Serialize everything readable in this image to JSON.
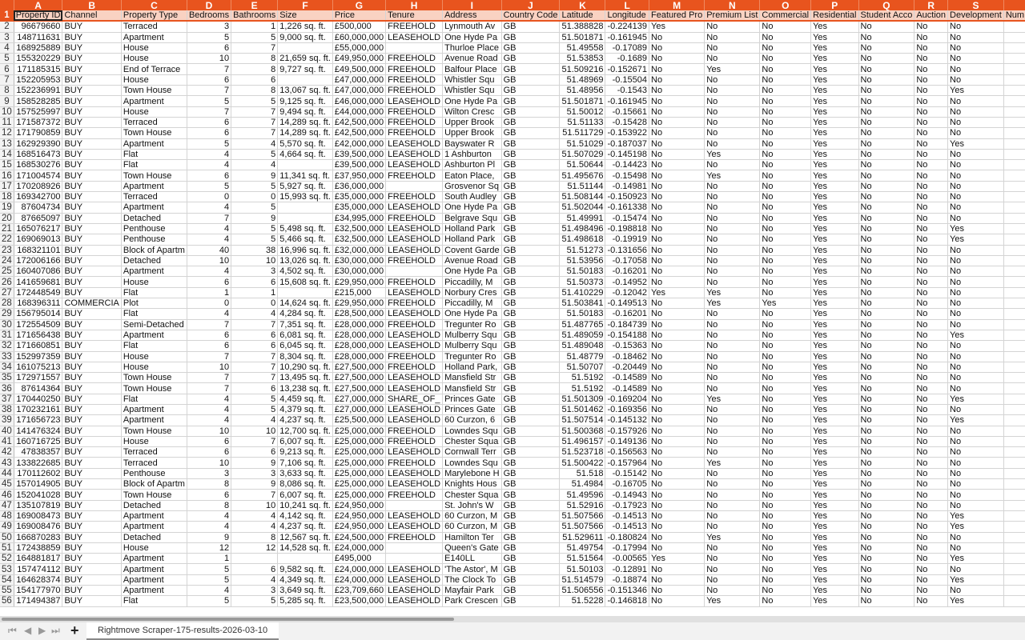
{
  "columns": [
    "A",
    "B",
    "C",
    "D",
    "E",
    "F",
    "G",
    "H",
    "I",
    "J",
    "K",
    "L",
    "M",
    "N",
    "O",
    "P",
    "Q",
    "R",
    "S",
    ""
  ],
  "headers": [
    "Property ID",
    "Channel",
    "Property Type",
    "Bedrooms",
    "Bathrooms",
    "Size",
    "Price",
    "Tenure",
    "Address",
    "Country Code",
    "Latitude",
    "Longitude",
    "Featured Pro",
    "Premium List",
    "Commercial",
    "Residential",
    "Student Acco",
    "Auction",
    "Development",
    "Num"
  ],
  "rows": [
    [
      "96679660",
      "BUY",
      "Terraced",
      "3",
      "1",
      "1,226 sq. ft.",
      "£500,000",
      "FREEHOLD",
      "Lynmouth Av",
      "GB",
      "51.388828",
      "-0.224139",
      "Yes",
      "No",
      "No",
      "Yes",
      "No",
      "No",
      "No"
    ],
    [
      "148711631",
      "BUY",
      "Apartment",
      "5",
      "5",
      "9,000 sq. ft.",
      "£60,000,000",
      "LEASEHOLD",
      "One Hyde Pa",
      "GB",
      "51.501871",
      "-0.161945",
      "No",
      "No",
      "No",
      "Yes",
      "No",
      "No",
      "No"
    ],
    [
      "168925889",
      "BUY",
      "House",
      "6",
      "7",
      "",
      "£55,000,000",
      "",
      "Thurloe Place",
      "GB",
      "51.49558",
      "-0.17089",
      "No",
      "No",
      "No",
      "Yes",
      "No",
      "No",
      "No"
    ],
    [
      "155320229",
      "BUY",
      "House",
      "10",
      "8",
      "21,659 sq. ft.",
      "£49,950,000",
      "FREEHOLD",
      "Avenue Road",
      "GB",
      "51.53853",
      "-0.1689",
      "No",
      "No",
      "No",
      "Yes",
      "No",
      "No",
      "No"
    ],
    [
      "171185315",
      "BUY",
      "End of Terrace",
      "7",
      "8",
      "9,727 sq. ft.",
      "£49,500,000",
      "FREEHOLD",
      "Balfour Place",
      "GB",
      "51.509216",
      "-0.152671",
      "No",
      "Yes",
      "No",
      "Yes",
      "No",
      "No",
      "No"
    ],
    [
      "152205953",
      "BUY",
      "House",
      "6",
      "6",
      "",
      "£47,000,000",
      "FREEHOLD",
      "Whistler Squ",
      "GB",
      "51.48969",
      "-0.15504",
      "No",
      "No",
      "No",
      "Yes",
      "No",
      "No",
      "No"
    ],
    [
      "152236991",
      "BUY",
      "Town House",
      "7",
      "8",
      "13,067 sq. ft.",
      "£47,000,000",
      "FREEHOLD",
      "Whistler Squ",
      "GB",
      "51.48956",
      "-0.1543",
      "No",
      "No",
      "No",
      "Yes",
      "No",
      "No",
      "Yes"
    ],
    [
      "158528285",
      "BUY",
      "Apartment",
      "5",
      "5",
      "9,125 sq. ft.",
      "£46,000,000",
      "LEASEHOLD",
      "One Hyde Pa",
      "GB",
      "51.501871",
      "-0.161945",
      "No",
      "No",
      "No",
      "Yes",
      "No",
      "No",
      "No"
    ],
    [
      "157525997",
      "BUY",
      "House",
      "7",
      "7",
      "9,494 sq. ft.",
      "£44,000,000",
      "FREEHOLD",
      "Wilton Cresc",
      "GB",
      "51.50012",
      "-0.15661",
      "No",
      "No",
      "No",
      "Yes",
      "No",
      "No",
      "No"
    ],
    [
      "171587372",
      "BUY",
      "Terraced",
      "6",
      "7",
      "14,289 sq. ft.",
      "£42,500,000",
      "FREEHOLD",
      "Upper Brook",
      "GB",
      "51.51133",
      "-0.15428",
      "No",
      "No",
      "No",
      "Yes",
      "No",
      "No",
      "No"
    ],
    [
      "171790859",
      "BUY",
      "Town House",
      "6",
      "7",
      "14,289 sq. ft.",
      "£42,500,000",
      "FREEHOLD",
      "Upper Brook",
      "GB",
      "51.511729",
      "-0.153922",
      "No",
      "No",
      "No",
      "Yes",
      "No",
      "No",
      "No"
    ],
    [
      "162929390",
      "BUY",
      "Apartment",
      "5",
      "4",
      "5,570 sq. ft.",
      "£42,000,000",
      "LEASEHOLD",
      "Bayswater R",
      "GB",
      "51.51029",
      "-0.187037",
      "No",
      "No",
      "No",
      "Yes",
      "No",
      "No",
      "Yes"
    ],
    [
      "168516473",
      "BUY",
      "Flat",
      "4",
      "5",
      "4,664 sq. ft.",
      "£39,500,000",
      "LEASEHOLD",
      "1 Ashburton",
      "GB",
      "51.507029",
      "-0.145198",
      "No",
      "Yes",
      "No",
      "Yes",
      "No",
      "No",
      "No"
    ],
    [
      "168530276",
      "BUY",
      "Flat",
      "4",
      "4",
      "",
      "£39,500,000",
      "LEASEHOLD",
      "Ashburton Pl",
      "GB",
      "51.50644",
      "-0.14423",
      "No",
      "No",
      "No",
      "Yes",
      "No",
      "No",
      "No"
    ],
    [
      "171004574",
      "BUY",
      "Town House",
      "6",
      "9",
      "11,341 sq. ft.",
      "£37,950,000",
      "FREEHOLD",
      "Eaton Place,",
      "GB",
      "51.495676",
      "-0.15498",
      "No",
      "Yes",
      "No",
      "Yes",
      "No",
      "No",
      "No"
    ],
    [
      "170208926",
      "BUY",
      "Apartment",
      "5",
      "5",
      "5,927 sq. ft.",
      "£36,000,000",
      "",
      "Grosvenor Sq",
      "GB",
      "51.51144",
      "-0.14981",
      "No",
      "No",
      "No",
      "Yes",
      "No",
      "No",
      "No"
    ],
    [
      "169342700",
      "BUY",
      "Terraced",
      "0",
      "0",
      "15,993 sq. ft.",
      "£35,000,000",
      "FREEHOLD",
      "South Audley",
      "GB",
      "51.508144",
      "-0.150923",
      "No",
      "No",
      "No",
      "Yes",
      "No",
      "No",
      "No"
    ],
    [
      "87604734",
      "BUY",
      "Apartment",
      "4",
      "5",
      "",
      "£35,000,000",
      "LEASEHOLD",
      "One Hyde Pa",
      "GB",
      "51.502044",
      "-0.161338",
      "No",
      "No",
      "No",
      "Yes",
      "No",
      "No",
      "No"
    ],
    [
      "87665097",
      "BUY",
      "Detached",
      "7",
      "9",
      "",
      "£34,995,000",
      "FREEHOLD",
      "Belgrave Squ",
      "GB",
      "51.49991",
      "-0.15474",
      "No",
      "No",
      "No",
      "Yes",
      "No",
      "No",
      "No"
    ],
    [
      "165076217",
      "BUY",
      "Penthouse",
      "4",
      "5",
      "5,498 sq. ft.",
      "£32,500,000",
      "LEASEHOLD",
      "Holland Park",
      "GB",
      "51.498496",
      "-0.198818",
      "No",
      "No",
      "No",
      "Yes",
      "No",
      "No",
      "Yes"
    ],
    [
      "169069013",
      "BUY",
      "Penthouse",
      "4",
      "5",
      "5,466 sq. ft.",
      "£32,500,000",
      "LEASEHOLD",
      "Holland Park",
      "GB",
      "51.498618",
      "-0.19919",
      "No",
      "No",
      "No",
      "Yes",
      "No",
      "No",
      "Yes"
    ],
    [
      "168321101",
      "BUY",
      "Block of Apartm",
      "40",
      "38",
      "16,996 sq. ft.",
      "£32,000,000",
      "LEASEHOLD",
      "Covent Garde",
      "GB",
      "51.51273",
      "-0.131656",
      "No",
      "No",
      "No",
      "Yes",
      "No",
      "No",
      "No"
    ],
    [
      "172006166",
      "BUY",
      "Detached",
      "10",
      "10",
      "13,026 sq. ft.",
      "£30,000,000",
      "FREEHOLD",
      "Avenue Road",
      "GB",
      "51.53956",
      "-0.17058",
      "No",
      "No",
      "No",
      "Yes",
      "No",
      "No",
      "No"
    ],
    [
      "160407086",
      "BUY",
      "Apartment",
      "4",
      "3",
      "4,502 sq. ft.",
      "£30,000,000",
      "",
      "One Hyde Pa",
      "GB",
      "51.50183",
      "-0.16201",
      "No",
      "No",
      "No",
      "Yes",
      "No",
      "No",
      "No"
    ],
    [
      "141659681",
      "BUY",
      "House",
      "6",
      "6",
      "15,608 sq. ft.",
      "£29,950,000",
      "FREEHOLD",
      "Piccadilly, M",
      "GB",
      "51.50373",
      "-0.14952",
      "No",
      "No",
      "No",
      "Yes",
      "No",
      "No",
      "No"
    ],
    [
      "172448549",
      "BUY",
      "Flat",
      "1",
      "1",
      "",
      "£215,000",
      "LEASEHOLD",
      "Norbury Cres",
      "GB",
      "51.410229",
      "-0.12042",
      "Yes",
      "Yes",
      "No",
      "Yes",
      "No",
      "No",
      "No"
    ],
    [
      "168396311",
      "COMMERCIA",
      "Plot",
      "0",
      "0",
      "14,624 sq. ft.",
      "£29,950,000",
      "FREEHOLD",
      "Piccadilly, M",
      "GB",
      "51.503841",
      "-0.149513",
      "No",
      "Yes",
      "Yes",
      "Yes",
      "No",
      "No",
      "No"
    ],
    [
      "156795014",
      "BUY",
      "Flat",
      "4",
      "4",
      "4,284 sq. ft.",
      "£28,500,000",
      "LEASEHOLD",
      "One Hyde Pa",
      "GB",
      "51.50183",
      "-0.16201",
      "No",
      "No",
      "No",
      "Yes",
      "No",
      "No",
      "No"
    ],
    [
      "172554509",
      "BUY",
      "Semi-Detached",
      "7",
      "7",
      "7,351 sq. ft.",
      "£28,000,000",
      "FREEHOLD",
      "Tregunter Ro",
      "GB",
      "51.487765",
      "-0.184739",
      "No",
      "No",
      "No",
      "Yes",
      "No",
      "No",
      "No"
    ],
    [
      "171656438",
      "BUY",
      "Apartment",
      "6",
      "6",
      "6,081 sq. ft.",
      "£28,000,000",
      "LEASEHOLD",
      "Mulberry Squ",
      "GB",
      "51.489059",
      "-0.154188",
      "No",
      "No",
      "No",
      "Yes",
      "No",
      "No",
      "Yes"
    ],
    [
      "171660851",
      "BUY",
      "Flat",
      "6",
      "6",
      "6,045 sq. ft.",
      "£28,000,000",
      "LEASEHOLD",
      "Mulberry Squ",
      "GB",
      "51.489048",
      "-0.15363",
      "No",
      "No",
      "No",
      "Yes",
      "No",
      "No",
      "No"
    ],
    [
      "152997359",
      "BUY",
      "House",
      "7",
      "7",
      "8,304 sq. ft.",
      "£28,000,000",
      "FREEHOLD",
      "Tregunter Ro",
      "GB",
      "51.48779",
      "-0.18462",
      "No",
      "No",
      "No",
      "Yes",
      "No",
      "No",
      "No"
    ],
    [
      "161075213",
      "BUY",
      "House",
      "10",
      "7",
      "10,290 sq. ft.",
      "£27,500,000",
      "FREEHOLD",
      "Holland Park,",
      "GB",
      "51.50707",
      "-0.20449",
      "No",
      "No",
      "No",
      "Yes",
      "No",
      "No",
      "No"
    ],
    [
      "172971557",
      "BUY",
      "Town House",
      "7",
      "7",
      "13,495 sq. ft.",
      "£27,500,000",
      "LEASEHOLD",
      "Mansfield Str",
      "GB",
      "51.5192",
      "-0.14589",
      "No",
      "No",
      "No",
      "Yes",
      "No",
      "No",
      "No"
    ],
    [
      "87614364",
      "BUY",
      "Town House",
      "7",
      "6",
      "13,238 sq. ft.",
      "£27,500,000",
      "LEASEHOLD",
      "Mansfield Str",
      "GB",
      "51.5192",
      "-0.14589",
      "No",
      "No",
      "No",
      "Yes",
      "No",
      "No",
      "No"
    ],
    [
      "170440250",
      "BUY",
      "Flat",
      "4",
      "5",
      "4,459 sq. ft.",
      "£27,000,000",
      "SHARE_OF_",
      "Princes Gate",
      "GB",
      "51.501309",
      "-0.169204",
      "No",
      "Yes",
      "No",
      "Yes",
      "No",
      "No",
      "Yes"
    ],
    [
      "170232161",
      "BUY",
      "Apartment",
      "4",
      "5",
      "4,379 sq. ft.",
      "£27,000,000",
      "LEASEHOLD",
      "Princes Gate",
      "GB",
      "51.501462",
      "-0.169356",
      "No",
      "No",
      "No",
      "Yes",
      "No",
      "No",
      "No"
    ],
    [
      "171656723",
      "BUY",
      "Apartment",
      "4",
      "4",
      "4,237 sq. ft.",
      "£25,500,000",
      "LEASEHOLD",
      "60 Curzon, 6",
      "GB",
      "51.507514",
      "-0.145132",
      "No",
      "No",
      "No",
      "Yes",
      "No",
      "No",
      "Yes"
    ],
    [
      "141476324",
      "BUY",
      "Town House",
      "10",
      "10",
      "12,700 sq. ft.",
      "£25,000,000",
      "FREEHOLD",
      "Lowndes Squ",
      "GB",
      "51.500368",
      "-0.157926",
      "No",
      "No",
      "No",
      "Yes",
      "No",
      "No",
      "No"
    ],
    [
      "160716725",
      "BUY",
      "House",
      "6",
      "7",
      "6,007 sq. ft.",
      "£25,000,000",
      "FREEHOLD",
      "Chester Squa",
      "GB",
      "51.496157",
      "-0.149136",
      "No",
      "No",
      "No",
      "Yes",
      "No",
      "No",
      "No"
    ],
    [
      "47838357",
      "BUY",
      "Terraced",
      "6",
      "6",
      "9,213 sq. ft.",
      "£25,000,000",
      "LEASEHOLD",
      "Cornwall Terr",
      "GB",
      "51.523718",
      "-0.156563",
      "No",
      "No",
      "No",
      "Yes",
      "No",
      "No",
      "No"
    ],
    [
      "133822685",
      "BUY",
      "Terraced",
      "10",
      "9",
      "7,106 sq. ft.",
      "£25,000,000",
      "FREEHOLD",
      "Lowndes Squ",
      "GB",
      "51.500422",
      "-0.157964",
      "No",
      "Yes",
      "No",
      "Yes",
      "No",
      "No",
      "No"
    ],
    [
      "170112602",
      "BUY",
      "Penthouse",
      "3",
      "3",
      "3,633 sq. ft.",
      "£25,000,000",
      "LEASEHOLD",
      "Marylebone H",
      "GB",
      "51.518",
      "-0.15142",
      "No",
      "No",
      "No",
      "Yes",
      "No",
      "No",
      "No"
    ],
    [
      "157014905",
      "BUY",
      "Block of Apartm",
      "8",
      "9",
      "8,086 sq. ft.",
      "£25,000,000",
      "LEASEHOLD",
      "Knights Hous",
      "GB",
      "51.4984",
      "-0.16705",
      "No",
      "No",
      "No",
      "Yes",
      "No",
      "No",
      "No"
    ],
    [
      "152041028",
      "BUY",
      "Town House",
      "6",
      "7",
      "6,007 sq. ft.",
      "£25,000,000",
      "FREEHOLD",
      "Chester Squa",
      "GB",
      "51.49596",
      "-0.14943",
      "No",
      "No",
      "No",
      "Yes",
      "No",
      "No",
      "No"
    ],
    [
      "135107819",
      "BUY",
      "Detached",
      "8",
      "10",
      "10,241 sq. ft.",
      "£24,950,000",
      "",
      "St. John's W",
      "GB",
      "51.52916",
      "-0.17923",
      "No",
      "No",
      "No",
      "Yes",
      "No",
      "No",
      "No"
    ],
    [
      "169008473",
      "BUY",
      "Apartment",
      "4",
      "4",
      "4,142 sq. ft.",
      "£24,950,000",
      "LEASEHOLD",
      "60 Curzon, M",
      "GB",
      "51.507566",
      "-0.14513",
      "No",
      "No",
      "No",
      "Yes",
      "No",
      "No",
      "Yes"
    ],
    [
      "169008476",
      "BUY",
      "Apartment",
      "4",
      "4",
      "4,237 sq. ft.",
      "£24,950,000",
      "LEASEHOLD",
      "60 Curzon, M",
      "GB",
      "51.507566",
      "-0.14513",
      "No",
      "No",
      "No",
      "Yes",
      "No",
      "No",
      "Yes"
    ],
    [
      "166870283",
      "BUY",
      "Detached",
      "9",
      "8",
      "12,567 sq. ft.",
      "£24,500,000",
      "FREEHOLD",
      "Hamilton Ter",
      "GB",
      "51.529611",
      "-0.180824",
      "No",
      "Yes",
      "No",
      "Yes",
      "No",
      "No",
      "No"
    ],
    [
      "172438859",
      "BUY",
      "House",
      "12",
      "12",
      "14,528 sq. ft.",
      "£24,000,000",
      "",
      "Queen's Gate",
      "GB",
      "51.49754",
      "-0.17994",
      "No",
      "No",
      "No",
      "Yes",
      "No",
      "No",
      "No"
    ],
    [
      "164881817",
      "BUY",
      "Apartment",
      "1",
      "",
      "",
      "£495,000",
      "",
      "E140LL",
      "GB",
      "51.51564",
      "-0.00565",
      "Yes",
      "No",
      "No",
      "Yes",
      "No",
      "No",
      "Yes"
    ],
    [
      "157474112",
      "BUY",
      "Apartment",
      "5",
      "6",
      "9,582 sq. ft.",
      "£24,000,000",
      "LEASEHOLD",
      "'The Astor', M",
      "GB",
      "51.50103",
      "-0.12891",
      "No",
      "No",
      "No",
      "Yes",
      "No",
      "No",
      "No"
    ],
    [
      "164628374",
      "BUY",
      "Apartment",
      "5",
      "4",
      "4,349 sq. ft.",
      "£24,000,000",
      "LEASEHOLD",
      "The Clock To",
      "GB",
      "51.514579",
      "-0.18874",
      "No",
      "No",
      "No",
      "Yes",
      "No",
      "No",
      "Yes"
    ],
    [
      "154177970",
      "BUY",
      "Apartment",
      "4",
      "3",
      "3,649 sq. ft.",
      "£23,709,660",
      "LEASEHOLD",
      "Mayfair Park",
      "GB",
      "51.506556",
      "-0.151346",
      "No",
      "No",
      "No",
      "Yes",
      "No",
      "No",
      "No"
    ],
    [
      "171494387",
      "BUY",
      "Flat",
      "5",
      "5",
      "5,285 sq. ft.",
      "£23,500,000",
      "LEASEHOLD",
      "Park Crescen",
      "GB",
      "51.5228",
      "-0.146818",
      "No",
      "Yes",
      "No",
      "Yes",
      "No",
      "No",
      "Yes"
    ]
  ],
  "sheet_tab": "Rightmove Scraper-175-results-2026-03-10",
  "nav": {
    "first": "⏮",
    "prev": "◀",
    "next": "▶",
    "last": "⏭",
    "add": "+"
  }
}
